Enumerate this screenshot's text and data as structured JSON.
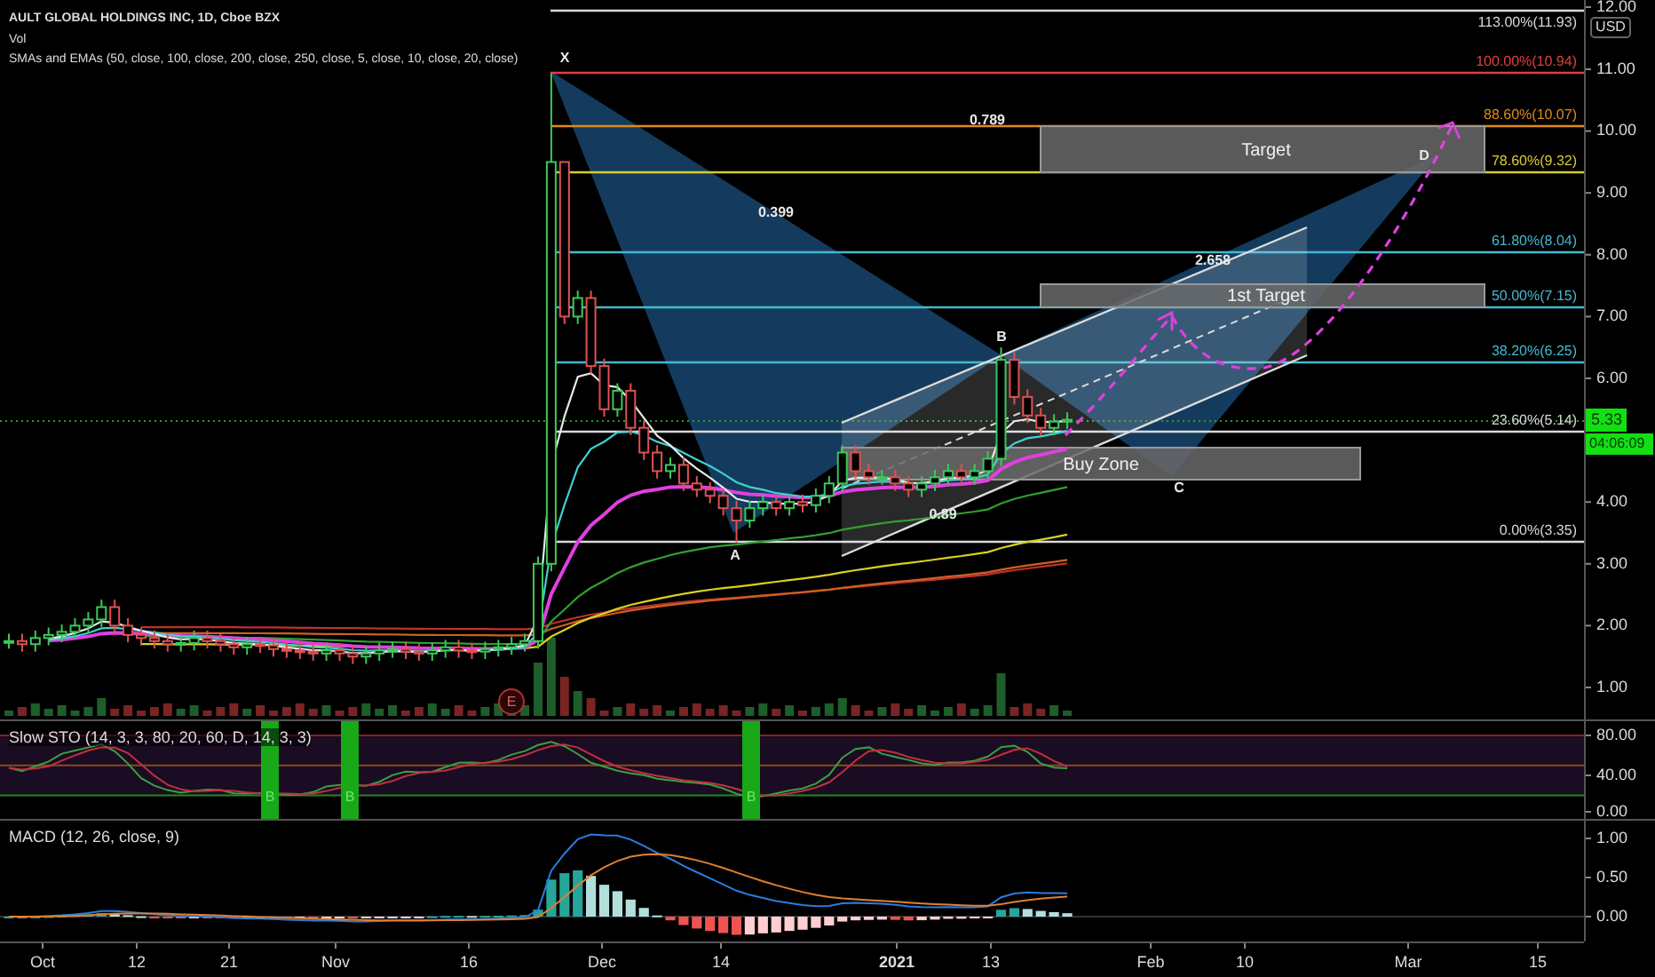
{
  "header": {
    "title": "AULT GLOBAL HOLDINGS INC, 1D, Cboe BZX",
    "indicators": [
      "Vol",
      "SMAs and EMAs (50, close, 100, close, 200, close, 250, close, 5, close, 10, close, 20, close)"
    ]
  },
  "price_axis": {
    "currency": "USD",
    "ticks": [
      "12.00",
      "11.00",
      "10.00",
      "9.00",
      "8.00",
      "7.00",
      "6.00",
      "4.00",
      "3.00",
      "2.00",
      "1.00"
    ],
    "last_price": "5.33",
    "countdown": "04:06:09"
  },
  "fib_levels": [
    {
      "label": "113.00%(11.93)",
      "color": "#d8d8d8"
    },
    {
      "label": "100.00%(10.94)",
      "color": "#e0403c"
    },
    {
      "label": "88.60%(10.07)",
      "color": "#e08a1e"
    },
    {
      "label": "78.60%(9.32)",
      "color": "#d8cc30"
    },
    {
      "label": "61.80%(8.04)",
      "color": "#45b8d0"
    },
    {
      "label": "50.00%(7.15)",
      "color": "#45b8d0"
    },
    {
      "label": "38.20%(6.25)",
      "color": "#45b8d0"
    },
    {
      "label": "23.60%(5.14)",
      "color": "#d8d8d8"
    },
    {
      "label": "0.00%(3.35)",
      "color": "#d8d8d8"
    }
  ],
  "pattern": {
    "points": [
      "X",
      "A",
      "B",
      "C",
      "D"
    ],
    "ratios": [
      "0.399",
      "0.789",
      "2.658",
      "0.89"
    ]
  },
  "zones": [
    {
      "label": "Target"
    },
    {
      "label": "1st Target"
    },
    {
      "label": "Buy Zone"
    }
  ],
  "event_marker": "E",
  "stochastic": {
    "legend": "Slow STO (14, 3, 3, 80, 20, 60, D, 14, 3, 3)",
    "ticks": [
      "80.00",
      "40.00",
      "0.00"
    ],
    "signals": [
      "B",
      "B",
      "B"
    ]
  },
  "macd": {
    "legend": "MACD (12, 26, close, 9)",
    "ticks": [
      "1.00",
      "0.50",
      "0.00"
    ]
  },
  "time_axis": [
    "Oct",
    "12",
    "21",
    "Nov",
    "16",
    "Dec",
    "14",
    "2021",
    "13",
    "Feb",
    "10",
    "Mar",
    "15"
  ]
}
